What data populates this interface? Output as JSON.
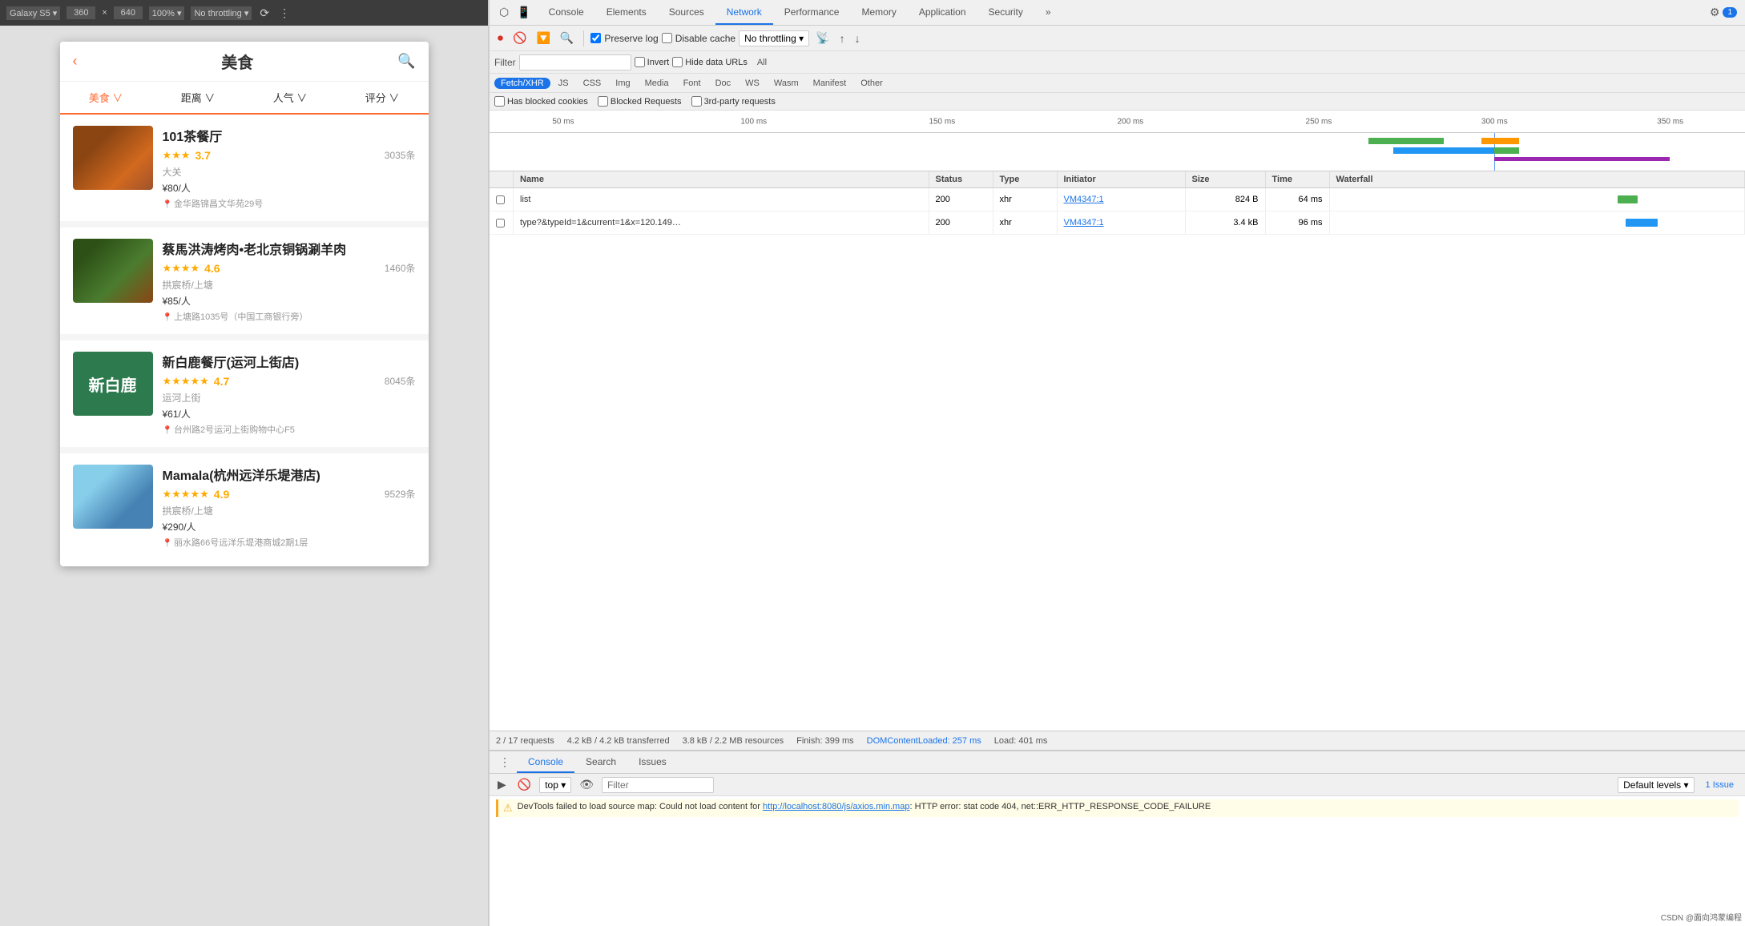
{
  "deviceToolbar": {
    "deviceLabel": "Galaxy S5",
    "width": "360",
    "cross": "×",
    "height": "640",
    "zoom": "100%",
    "throttle": "No throttling",
    "moreIcon": "⋮"
  },
  "app": {
    "title": "美食",
    "backIcon": "‹",
    "searchIcon": "🔍",
    "filters": [
      {
        "label": "美食",
        "hasChevron": true
      },
      {
        "label": "距离",
        "hasChevron": true
      },
      {
        "label": "人气",
        "hasChevron": true
      },
      {
        "label": "评分",
        "hasChevron": true
      }
    ],
    "restaurants": [
      {
        "name": "101茶餐厅",
        "rating": "3.7",
        "stars": "★★★☆☆",
        "reviewCount": "3035条",
        "location": "大关",
        "price": "¥80/人",
        "address": "金华路锦昌文华苑29号",
        "imgClass": "img1"
      },
      {
        "name": "蔡馬洪涛烤肉•老北京铜锅涮羊肉",
        "rating": "4.6",
        "stars": "★★★★☆",
        "reviewCount": "1460条",
        "location": "拱宸桥/上塘",
        "price": "¥85/人",
        "address": "上塘路1035号（中国工商银行旁）",
        "imgClass": "img2"
      },
      {
        "name": "新白鹿餐厅(运河上街店)",
        "rating": "4.7",
        "stars": "★★★★★",
        "reviewCount": "8045条",
        "location": "运河上街",
        "price": "¥61/人",
        "address": "台州路2号运河上街购物中心F5",
        "imgClass": "img3",
        "imgText": "新白鹿"
      },
      {
        "name": "Mamala(杭州远洋乐堤港店)",
        "rating": "4.9",
        "stars": "★★★★★",
        "reviewCount": "9529条",
        "location": "拱宸桥/上塘",
        "price": "¥290/人",
        "address": "丽水路66号远洋乐堤港商城2期1层",
        "imgClass": "img4"
      }
    ]
  },
  "devtools": {
    "tabs": [
      "Console",
      "Elements",
      "Sources",
      "Network",
      "Performance",
      "Memory",
      "Application",
      "Security"
    ],
    "activeTab": "Network",
    "moreTabsIcon": "»",
    "sideIcon": "1",
    "networkToolbar": {
      "recordIcon": "⏺",
      "stopIcon": "🚫",
      "filterIcon": "🔽",
      "searchIcon": "🔍",
      "preserveLog": "Preserve log",
      "disableCache": "Disable cache",
      "throttleLabel": "No throttling",
      "offlineIcon": "📡",
      "uploadIcon": "↑",
      "downloadIcon": "↓"
    },
    "filterBar": {
      "filterLabel": "Filter",
      "invertLabel": "Invert",
      "hideDataUrls": "Hide data URLs",
      "allLabel": "All"
    },
    "typeFilters": [
      "Fetch/XHR",
      "JS",
      "CSS",
      "Img",
      "Media",
      "Font",
      "Doc",
      "WS",
      "Wasm",
      "Manifest",
      "Other"
    ],
    "activeType": "Fetch/XHR",
    "checkboxFilters": {
      "hasBlocked": "Has blocked cookies",
      "blockedRequests": "Blocked Requests",
      "thirdParty": "3rd-party requests"
    },
    "timeline": {
      "ticks": [
        "50 ms",
        "100 ms",
        "150 ms",
        "200 ms",
        "250 ms",
        "300 ms",
        "350 ms"
      ],
      "tickPositions": [
        5,
        20,
        35,
        50,
        65,
        80,
        94
      ]
    },
    "tableHeaders": [
      "",
      "Name",
      "Status",
      "Type",
      "Initiator",
      "Size",
      "Time",
      "Waterfall"
    ],
    "tableRows": [
      {
        "name": "list",
        "status": "200",
        "type": "xhr",
        "initiator": "VM4347:1",
        "size": "824 B",
        "time": "64 ms",
        "waterfallColor": "#4caf50",
        "waterfallLeft": "70%",
        "waterfallWidth": "5%"
      },
      {
        "name": "type?&typeId=1&current=1&x=120.149…",
        "status": "200",
        "type": "xhr",
        "initiator": "VM4347:1",
        "size": "3.4 kB",
        "time": "96 ms",
        "waterfallColor": "#2196f3",
        "waterfallLeft": "72%",
        "waterfallWidth": "8%"
      }
    ],
    "statusBar": {
      "requests": "2 / 17 requests",
      "transferred": "4.2 kB / 4.2 kB transferred",
      "resources": "3.8 kB / 2.2 MB resources",
      "finish": "Finish: 399 ms",
      "domContentLoaded": "DOMContentLoaded: 257 ms",
      "load": "Load: 401 ms"
    },
    "bottomTabs": [
      "Console",
      "Search",
      "Issues"
    ],
    "activeBottomTab": "Console",
    "consoleTabs": {
      "top": "top",
      "filter": "Filter",
      "defaultLevels": "Default levels ▾",
      "issues": "1 Issue"
    },
    "consoleMessages": [
      {
        "type": "warning",
        "text": "DevTools failed to load source map: Could not load content for http://localhost:8080/js/axios.min.map: HTTP error: stat code 404, net::ERR_HTTP_RESPONSE_CODE_FAILURE"
      }
    ],
    "csdn": "CSDN @面向鸿蒙编程"
  }
}
